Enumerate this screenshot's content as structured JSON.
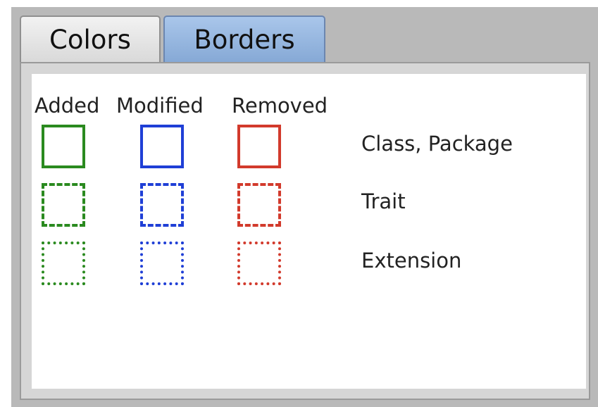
{
  "tabs": [
    {
      "label": "Colors",
      "selected": false
    },
    {
      "label": "Borders",
      "selected": true
    }
  ],
  "legend": {
    "columns": [
      "Added",
      "Modified",
      "Removed"
    ],
    "rows": [
      {
        "label": "Class, Package",
        "style": "solid"
      },
      {
        "label": "Trait",
        "style": "dashed"
      },
      {
        "label": "Extension",
        "style": "dotted"
      }
    ],
    "colors": {
      "added": "#2a8a1f",
      "modified": "#1f3fd6",
      "removed": "#d23a2c"
    }
  }
}
